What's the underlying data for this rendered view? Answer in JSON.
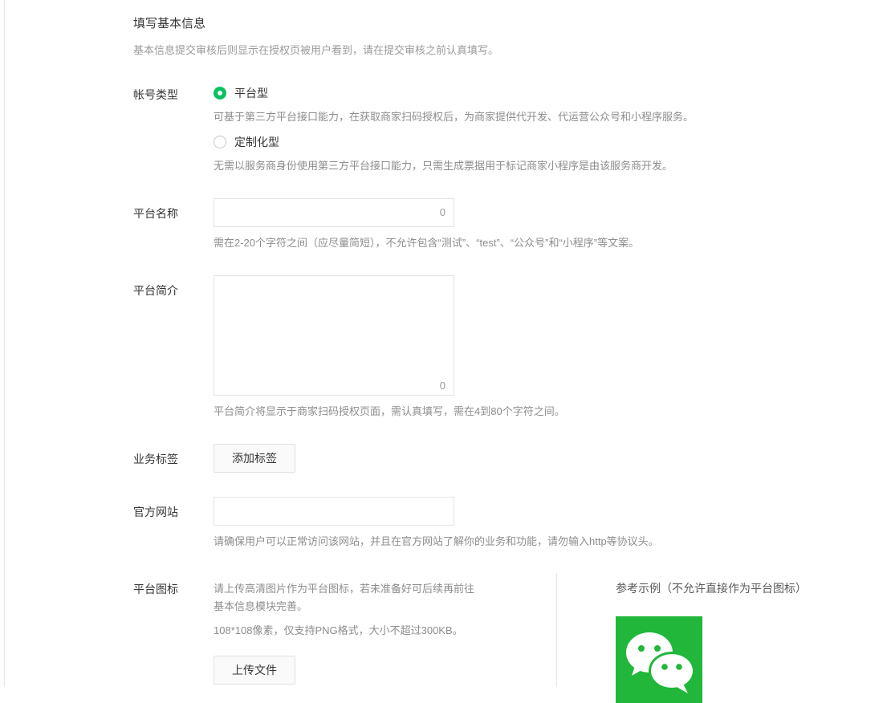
{
  "section": {
    "title": "填写基本信息",
    "description": "基本信息提交审核后则显示在授权页被用户看到，请在提交审核之前认真填写。"
  },
  "account_type": {
    "label": "帐号类型",
    "options": [
      {
        "label": "平台型",
        "selected": true,
        "tip": "可基于第三方平台接口能力，在获取商家扫码授权后，为商家提供代开发、代运营公众号和小程序服务。"
      },
      {
        "label": "定制化型",
        "selected": false,
        "tip": "无需以服务商身份使用第三方平台接口能力，只需生成票据用于标记商家小程序是由该服务商开发。"
      }
    ]
  },
  "platform_name": {
    "label": "平台名称",
    "value": "",
    "count": "0",
    "tip": "需在2-20个字符之间（应尽量简短），不允许包含“测试”、“test”、“公众号”和“小程序”等文案。"
  },
  "platform_intro": {
    "label": "平台简介",
    "value": "",
    "count": "0",
    "tip": "平台简介将显示于商家扫码授权页面，需认真填写，需在4到80个字符之间。"
  },
  "business_tags": {
    "label": "业务标签",
    "button": "添加标签"
  },
  "official_site": {
    "label": "官方网站",
    "value": "",
    "tip": "请确保用户可以正常访问该网站，并且在官方网站了解你的业务和功能，请勿输入http等协议头。"
  },
  "platform_icon": {
    "label": "平台图标",
    "tip_line1": "请上传高清图片作为平台图标，若未准备好可后续再前往",
    "tip_line2": "基本信息模块完善。",
    "spec": "108*108像素，仅支持PNG格式，大小不超过300KB。",
    "upload_button": "上传文件",
    "example_label": "参考示例（不允许直接作为平台图标）",
    "example_icon": "wechat-logo-icon"
  },
  "colors": {
    "accent": "#07c160",
    "logo_bg": "#20b73a"
  }
}
